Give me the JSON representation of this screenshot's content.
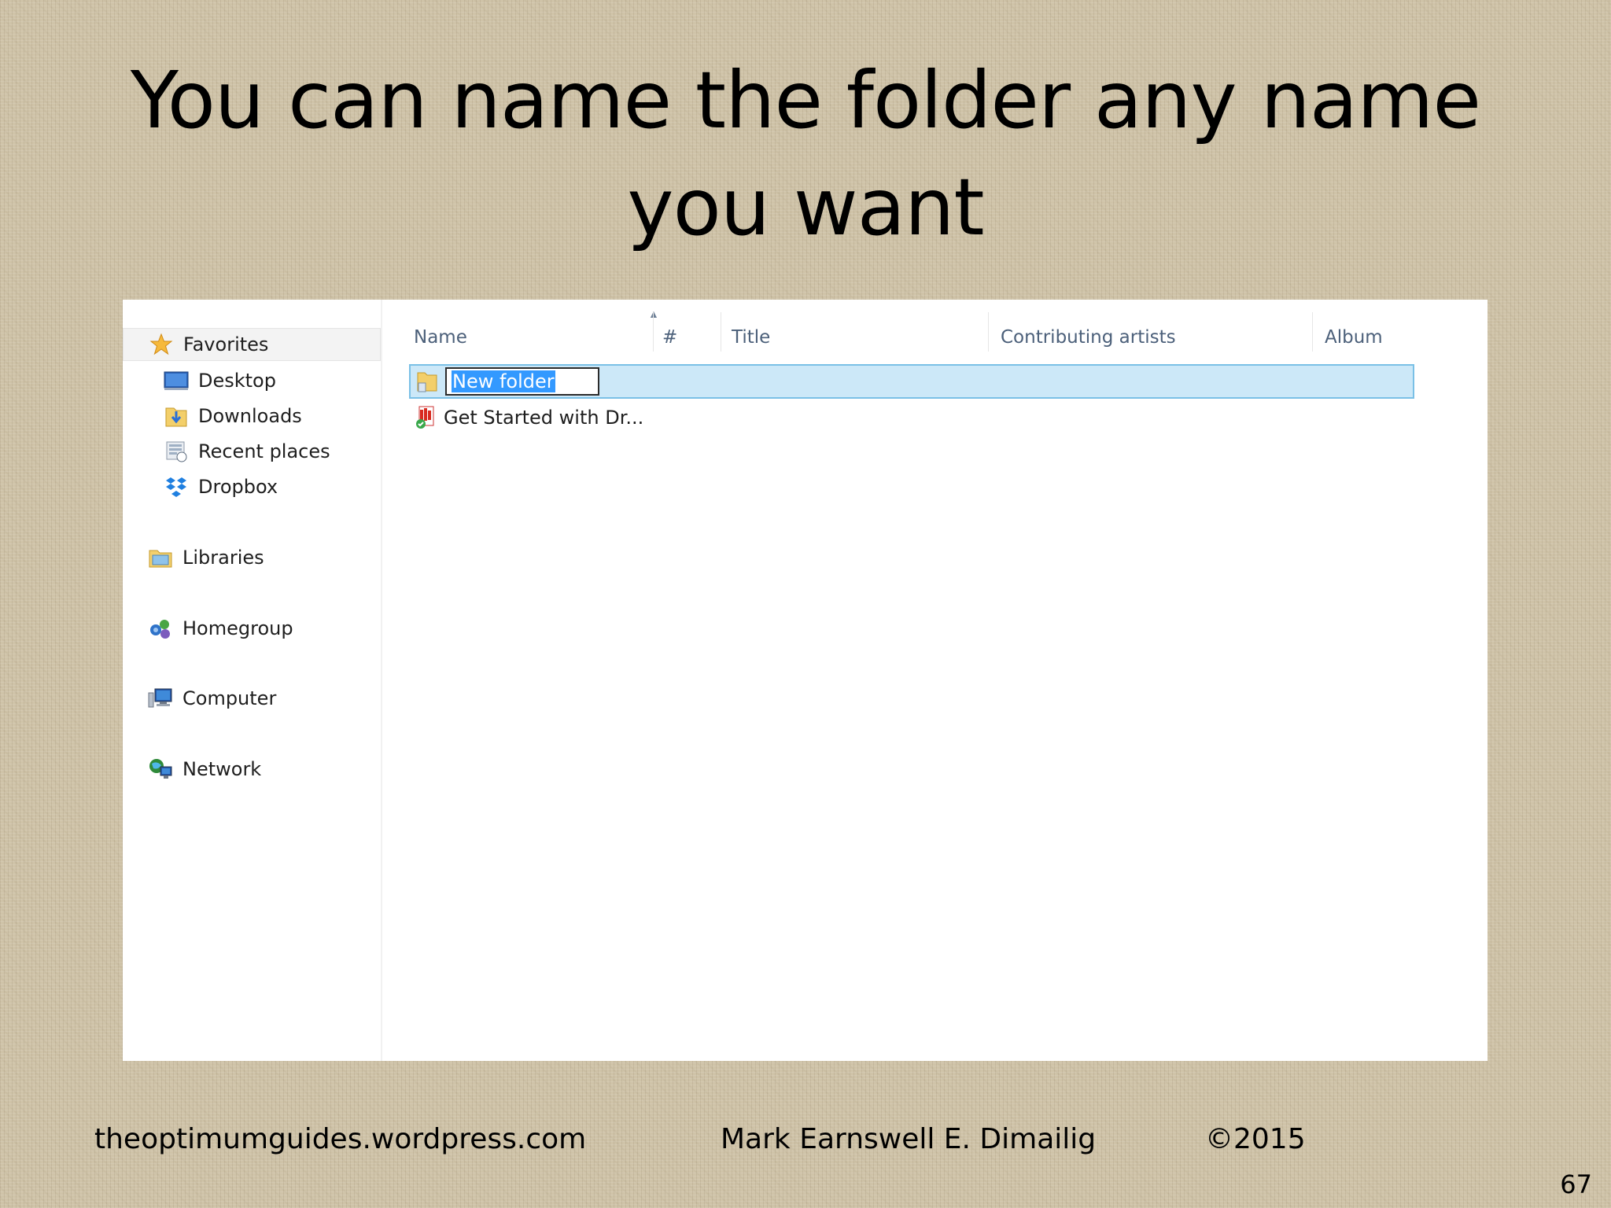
{
  "slide": {
    "title": "You can name the folder any name you want",
    "footer_site": "theoptimumguides.wordpress.com",
    "footer_author": "Mark Earnswell E. Dimailig",
    "footer_copyright": "©2015",
    "page_number": "67"
  },
  "explorer": {
    "nav": {
      "favorites": {
        "label": "Favorites",
        "icon": "star-icon"
      },
      "items": [
        {
          "label": "Desktop",
          "icon": "desktop-icon"
        },
        {
          "label": "Downloads",
          "icon": "downloads-folder-icon"
        },
        {
          "label": "Recent places",
          "icon": "recent-places-icon"
        },
        {
          "label": "Dropbox",
          "icon": "dropbox-icon"
        }
      ],
      "libraries": {
        "label": "Libraries",
        "icon": "libraries-icon"
      },
      "homegroup": {
        "label": "Homegroup",
        "icon": "homegroup-icon"
      },
      "computer": {
        "label": "Computer",
        "icon": "computer-icon"
      },
      "network": {
        "label": "Network",
        "icon": "network-icon"
      }
    },
    "columns": [
      "Name",
      "#",
      "Title",
      "Contributing artists",
      "Album"
    ],
    "files": [
      {
        "name": "New folder",
        "icon": "folder-icon",
        "editing": true,
        "selected": true
      },
      {
        "name": "Get Started with Dr...",
        "icon": "pdf-icon",
        "editing": false,
        "selected": false
      }
    ]
  },
  "colors": {
    "selection_fill": "#cce8f8",
    "selection_border": "#7ac0e6",
    "text_highlight": "#3399ff",
    "column_header_text": "#4c607a"
  }
}
